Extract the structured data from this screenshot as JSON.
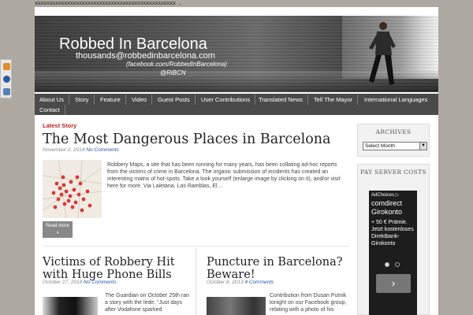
{
  "top_strip": "xxxxxxxxxxxxxxxxxxxxxxxxxxxxxxxxxxxxxxxxxxxxxxxx .",
  "site": {
    "title": "Robbed In Barcelona",
    "email": "thousands@robbedinbarcelona.com",
    "facebook": "(facebook.com/RobbedInBarcelona)",
    "twitter": "@RiBCN"
  },
  "nav": {
    "items": [
      "About Us",
      "Story",
      "Feature",
      "Video",
      "Guest Posts",
      "User Contributions",
      "Translated News",
      "Tell The Mayor",
      "International Languages",
      "Contact"
    ]
  },
  "social_icons": [
    "rss-icon",
    "globe-icon",
    "bookmark-icon"
  ],
  "main": {
    "section_label": "Latest Story",
    "featured": {
      "title": "The Most Dangerous Places in Barcelona",
      "date": "November 2, 2014",
      "comments": "No Comments",
      "excerpt": "Robbery Maps, a site that has been running for many years, has been collating ad-hoc reports from the victims of crime in Barcelona. The organic submission of incidents has created an interesting matrix of hot-spots. Take a look yourself (enlarge image by clicking on it), and/or visit here for more. Via Laietana, Las Ramblas, El…",
      "read_more": "Read more"
    },
    "post_left": {
      "title": "Victims of Robbery Hit with Huge Phone Bills",
      "date": "October 27, 2014",
      "comments": "No Comments",
      "excerpt": "The Guardian on October 25th ran a story with the lede: “Just days after Vodafone sparked"
    },
    "post_right": {
      "title": "Puncture in Barcelona? Beware!",
      "date": "October 8, 2013",
      "comments": "4 Comments",
      "excerpt": "Contribution from Dusan Putnik tonight on our Facebook group, relating with a photo of his"
    }
  },
  "sidebar": {
    "archives_title": "ARCHIVES",
    "archives_select": "Select Month",
    "server_title": "PAY SERVER COSTS",
    "ad": {
      "choices": "AdChoices ▷",
      "headline": "comdirect Girokonto",
      "body": "+ 50 € Prämie. Jetzt kostenloses Direktbank-Girokonto",
      "next_button": "›"
    }
  }
}
